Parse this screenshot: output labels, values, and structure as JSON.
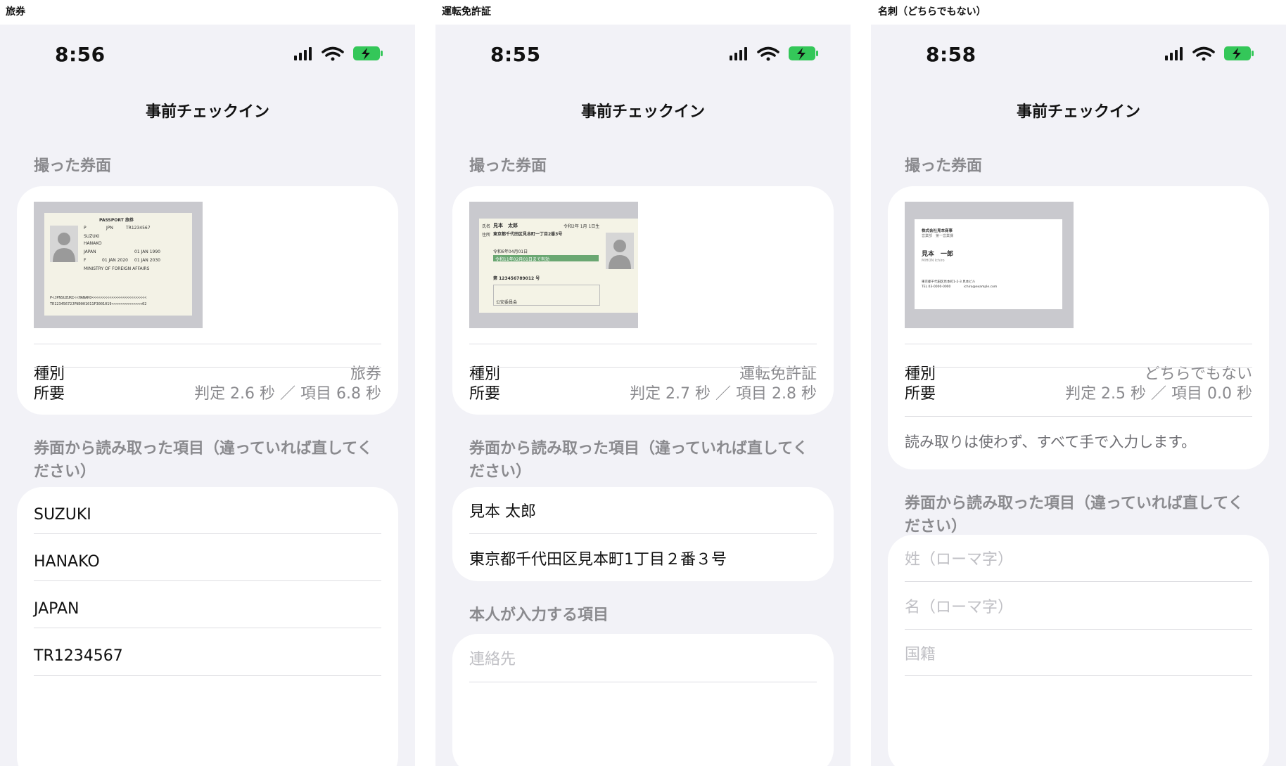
{
  "columns": [
    {
      "caption": "旅券",
      "time": "8:56",
      "title": "事前チェックイン",
      "photo_section": "撮った券面",
      "document": {
        "kind": "passport",
        "header": "PASSPORT  旅券",
        "type": "P",
        "country": "JPN",
        "number": "TR1234567",
        "surname": "SUZUKI",
        "given": "HANAKO",
        "nationality": "JAPAN",
        "birth": "01 JAN 1990",
        "sex": "F",
        "issue": "01 JAN 2020",
        "expiry": "01 JAN 2030",
        "authority": "MINISTRY OF FOREIGN AFFAIRS",
        "mrz1": "P<JPNSUZUKI<<HANAKO<<<<<<<<<<<<<<<<<<<<<<<<<",
        "mrz2": "TR12345672JPN9001011F3001019<<<<<<<<<<<<<<02"
      },
      "type_label": "種別",
      "type_value": "旅券",
      "time_label": "所要",
      "time_value": "判定 2.6 秒 ／ 項目 6.8 秒",
      "read_section": "券面から読み取った項目（違っていれば直してください）",
      "fields": [
        "SUZUKI",
        "HANAKO",
        "JAPAN",
        "TR1234567"
      ]
    },
    {
      "caption": "運転免許証",
      "time": "8:55",
      "title": "事前チェックイン",
      "photo_section": "撮った券面",
      "document": {
        "kind": "license",
        "name_label": "氏名",
        "name": "見本　太郎",
        "birth": "令和2年 1月 1日生",
        "addr_label": "住所",
        "address": "東京都千代田区見本町一丁目2番3号",
        "issued": "令和6年04月01日",
        "validity": "令和11年02月01日まで有効",
        "number": "第 123456789012 号",
        "footer": "公安委員会"
      },
      "type_label": "種別",
      "type_value": "運転免許証",
      "time_label": "所要",
      "time_value": "判定 2.7 秒 ／ 項目 2.8 秒",
      "read_section": "券面から読み取った項目（違っていれば直してください）",
      "fields": [
        "見本 太郎",
        "東京都千代田区見本町1丁目２番３号"
      ],
      "self_section": "本人が入力する項目",
      "self_placeholders": [
        "連絡先"
      ]
    },
    {
      "caption": "名刺（どちらでもない）",
      "time": "8:58",
      "title": "事前チェックイン",
      "photo_section": "撮った券面",
      "document": {
        "kind": "business-card",
        "company": "株式会社見本商事",
        "dept": "営業部　第一営業課",
        "name": "見本　一郎",
        "romaji": "MIHON Ichiro",
        "address": "東京都千代田区見本町1-2-3 見本ビル",
        "tel": "TEL 03-0000-0000",
        "mail": "ichiro@example.com"
      },
      "type_label": "種別",
      "type_value": "どちらでもない",
      "time_label": "所要",
      "time_value": "判定 2.5 秒 ／ 項目 0.0 秒",
      "note": "読み取りは使わず、すべて手で入力します。",
      "read_section": "券面から読み取った項目（違っていれば直してください）",
      "placeholders": [
        "姓（ローマ字）",
        "名（ローマ字）",
        "国籍"
      ]
    }
  ]
}
